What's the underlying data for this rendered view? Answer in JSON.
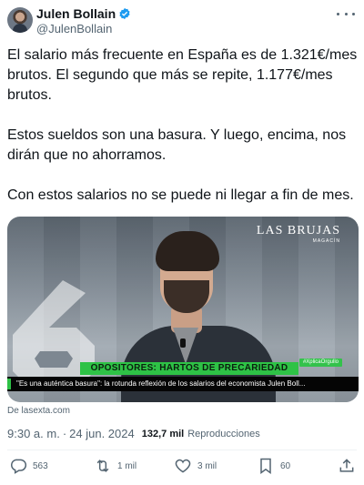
{
  "author": {
    "name": "Julen Bollain",
    "handle": "@JulenBollain",
    "verified_color": "#1d9bf0"
  },
  "tweet": {
    "paragraphs": [
      "El salario más frecuente en España es de 1.321€/mes brutos. El segundo que más se repite, 1.177€/mes brutos.",
      "Estos sueldos son una basura. Y luego, encima, nos dirán que no ahorramos.",
      "Con estos salarios no se puede ni llegar a fin de mes."
    ]
  },
  "media": {
    "logo_brand": "LAS BRUJAS",
    "logo_sub": "MAGACÍN",
    "hashtag": "#XplicaOrgullo",
    "headline": "OPOSITORES: HARTOS DE PRECARIEDAD",
    "caption": "\"Es una auténtica basura\": la rotunda reflexión de los salarios del economista Julen Boll...",
    "source": "De lasexta.com"
  },
  "meta": {
    "time": "9:30 a. m.",
    "separator": "·",
    "date": "24 jun. 2024",
    "views_count": "132,7 mil",
    "views_label": "Reproducciones"
  },
  "actions": {
    "replies": "563",
    "retweets": "1 mil",
    "likes": "3 mil",
    "bookmarks": "60"
  },
  "icons": {
    "more": "more-horizontal-icon",
    "verified": "verified-badge-icon",
    "reply": "reply-icon",
    "retweet": "retweet-icon",
    "like": "heart-icon",
    "bookmark": "bookmark-icon",
    "share": "share-icon"
  }
}
